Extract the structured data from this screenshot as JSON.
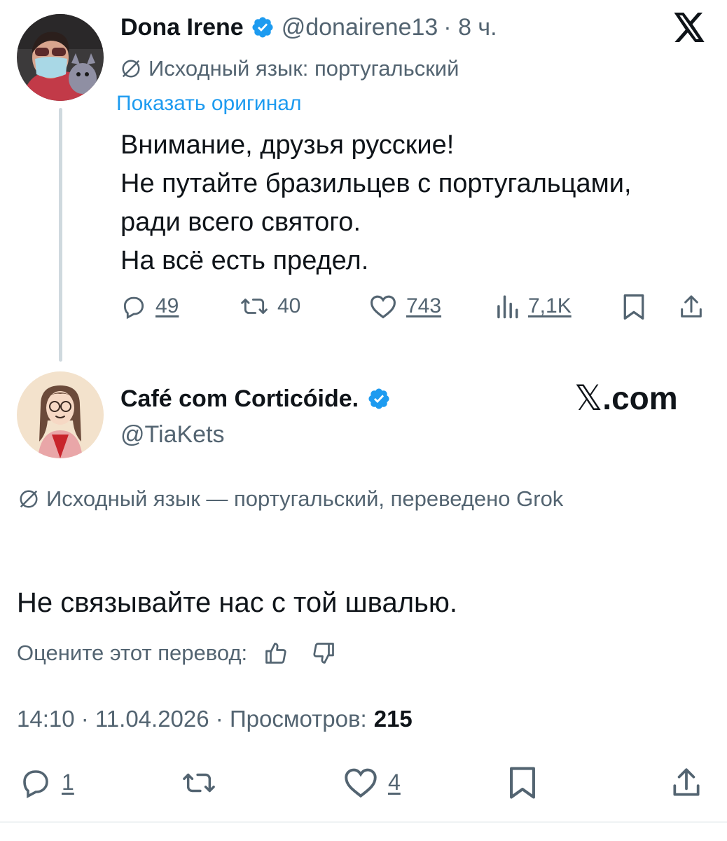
{
  "tweet1": {
    "author_name": "Dona Irene",
    "author_handle": "@donairene13",
    "time": "· 8 ч.",
    "source_language": "Исходный язык: португальский",
    "show_original": "Показать оригинал",
    "text_lines": [
      "Внимание, друзья русские!",
      "Не путайте бразильцев с португальцами,",
      "ради всего святого.",
      "На всё есть предел."
    ],
    "stats": {
      "replies": "49",
      "reposts": "40",
      "likes": "743",
      "views": "7,1K"
    }
  },
  "tweet2": {
    "author_name": "Café com Corticóide.",
    "author_handle": "@TiaKets",
    "source_language": "Исходный язык — португальский, переведено Grok",
    "text": "Не связывайте нас с той швалью.",
    "rate_label": "Оцените этот перевод:",
    "timestamp": "14:10 · 11.04.2026 · Просмотров:",
    "views_count": "215",
    "stats": {
      "replies": "1",
      "likes": "4"
    }
  },
  "watermark": {
    "x_letter": "𝕏",
    "domain_text": ".com"
  },
  "colors": {
    "accent": "#1d9bf0",
    "text": "#0f1419",
    "secondary": "#536471",
    "verified": "#1d9bf0"
  },
  "icons": [
    "x-logo-icon",
    "translate-icon",
    "verified-badge-icon",
    "reply-icon",
    "repost-icon",
    "like-icon",
    "views-icon",
    "bookmark-icon",
    "share-icon",
    "thumbs-up-icon",
    "thumbs-down-icon"
  ]
}
